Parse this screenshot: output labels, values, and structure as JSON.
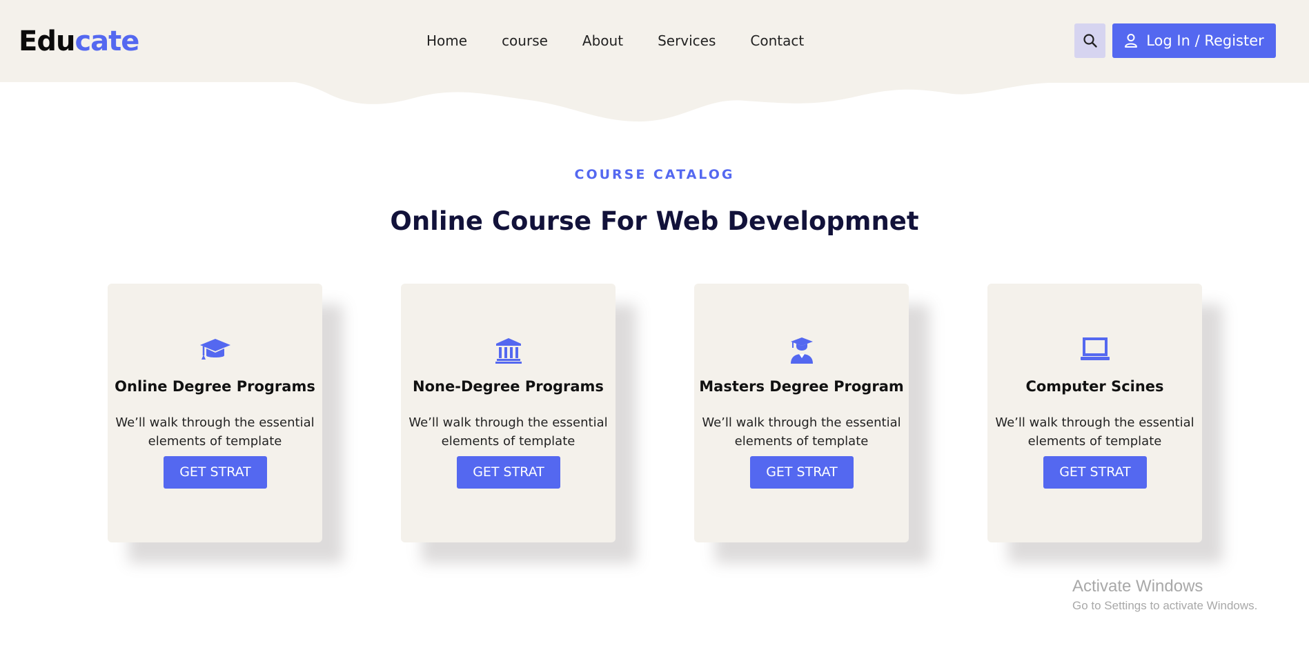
{
  "header": {
    "logo_part1": "Edu",
    "logo_part2": "cate",
    "nav": [
      "Home",
      "course",
      "About",
      "Services",
      "Contact"
    ],
    "search_icon": "search-icon",
    "login_label": "Log In / Register"
  },
  "section": {
    "eyebrow": "COURSE CATALOG",
    "heading": "Online Course For Web Developmnet"
  },
  "cards": [
    {
      "icon": "graduation-cap-icon",
      "title": "Online Degree Programs",
      "desc": "We’ll walk through the essential elements of template",
      "button": "GET STRAT"
    },
    {
      "icon": "institution-icon",
      "title": "None-Degree Programs",
      "desc": "We’ll walk through the essential elements of template",
      "button": "GET STRAT"
    },
    {
      "icon": "graduate-user-icon",
      "title": "Masters Degree Program",
      "desc": "We’ll walk through the essential elements of template",
      "button": "GET STRAT"
    },
    {
      "icon": "laptop-icon",
      "title": "Computer Scines",
      "desc": "We’ll walk through the essential elements of template",
      "button": "GET STRAT"
    }
  ],
  "watermark": {
    "line1": "Activate Windows",
    "line2": "Go to Settings to activate Windows."
  },
  "colors": {
    "accent": "#5468f0",
    "header_bg": "#f4f1eb",
    "heading": "#12123a"
  }
}
